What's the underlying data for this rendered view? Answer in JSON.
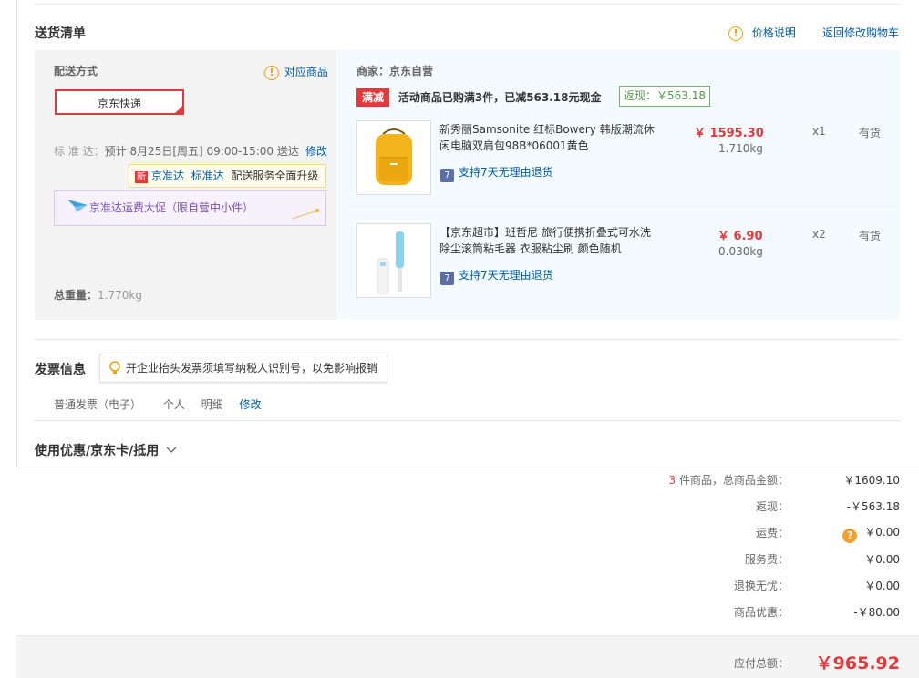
{
  "delivery": {
    "section_title": "送货清单",
    "price_info_link": "价格说明",
    "back_to_cart_link": "返回修改购物车",
    "method_label": "配送方式",
    "corresponding_goods": "对应商品",
    "selected_method": "京东快递",
    "standard_label": "标 准 达：",
    "standard_time": "预计 8月25日[周五] 09:00-15:00 送达",
    "modify_link": "修改",
    "new_badge": "新",
    "tip_link1": "京准达",
    "tip_link2": "标准达",
    "tip_text": "配送服务全面升级",
    "promo_text": "京准达运费大促（限自营中小件）",
    "total_weight_label": "总重量：",
    "total_weight": "1.770kg"
  },
  "merchant": {
    "label": "商家：京东自营",
    "promo_tag": "满减",
    "promo_text": "活动商品已购满3件，已减563.18元现金",
    "rebate_text": "返现：￥563.18"
  },
  "products": [
    {
      "name": "新秀丽Samsonite 红标Bowery 韩版潮流休闲电脑双肩包98B*06001黄色",
      "price": "￥ 1595.30",
      "weight": "1.710kg",
      "qty": "x1",
      "stock": "有货",
      "return_text": "支持7天无理由退货",
      "image_icon": "yellow-backpack-image"
    },
    {
      "name": "【京东超市】班哲尼 旅行便携折叠式可水洗除尘滚筒粘毛器 衣服粘尘刷 颜色随机",
      "price": "￥ 6.90",
      "weight": "0.030kg",
      "qty": "x2",
      "stock": "有货",
      "return_text": "支持7天无理由退货",
      "image_icon": "lint-roller-image"
    }
  ],
  "invoice": {
    "section_title": "发票信息",
    "tip": "开企业抬头发票须填写纳税人识别号，以免影响报销",
    "type": "普通发票（电子）",
    "title": "个人",
    "content": "明细",
    "modify_link": "修改"
  },
  "coupon": {
    "section_title": "使用优惠/京东卡/抵用"
  },
  "summary": {
    "count": "3",
    "count_label": "件商品，总商品金额：",
    "total_goods": "￥1609.10",
    "rebate_label": "返现：",
    "rebate": "-￥563.18",
    "freight_label": "运费：",
    "freight": "￥0.00",
    "service_label": "服务费：",
    "service": "￥0.00",
    "exchange_label": "退换无忧：",
    "exchange": "￥0.00",
    "discount_label": "商品优惠：",
    "discount": "-￥80.00",
    "payable_label": "应付总额：",
    "payable": "￥965.92"
  },
  "colors": {
    "accent_red": "#e4393c",
    "link_blue": "#005ea7",
    "rebate_green": "#4f9a4a",
    "warning_orange": "#f0a000"
  }
}
